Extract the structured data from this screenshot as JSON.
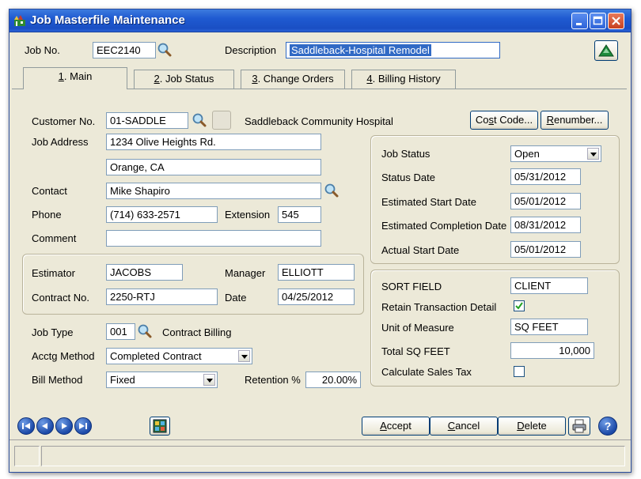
{
  "window": {
    "title": "Job Masterfile Maintenance"
  },
  "header": {
    "job_no_label": "Job No.",
    "job_no_value": "EEC2140",
    "description_label": "Description",
    "description_value": "Saddleback-Hospital Remodel"
  },
  "tabs": [
    {
      "key": "1",
      "label": ". Main"
    },
    {
      "key": "2",
      "label": ". Job Status"
    },
    {
      "key": "3",
      "label": ". Change Orders"
    },
    {
      "key": "4",
      "label": ". Billing History"
    }
  ],
  "customer": {
    "label": "Customer No.",
    "value": "01-SADDLE",
    "name": "Saddleback Community Hospital"
  },
  "buttons": {
    "cost_code": {
      "pre": "Co",
      "key": "s",
      "post": "t Code..."
    },
    "renumber": {
      "key": "R",
      "post": "enumber..."
    },
    "accept": {
      "key": "A",
      "post": "ccept"
    },
    "cancel": {
      "key": "C",
      "post": "ancel"
    },
    "delete": {
      "key": "D",
      "post": "elete"
    }
  },
  "address": {
    "label": "Job Address",
    "line1": "1234 Olive Heights Rd.",
    "line2": "Orange, CA"
  },
  "contact": {
    "label": "Contact",
    "value": "Mike Shapiro"
  },
  "phone": {
    "label": "Phone",
    "value": "(714) 633-2571",
    "ext_label": "Extension",
    "ext_value": "545"
  },
  "comment": {
    "label": "Comment",
    "value": ""
  },
  "estimator": {
    "label": "Estimator",
    "value": "JACOBS",
    "manager_label": "Manager",
    "manager_value": "ELLIOTT"
  },
  "contract": {
    "label": "Contract No.",
    "value": "2250-RTJ",
    "date_label": "Date",
    "date_value": "04/25/2012"
  },
  "job_type": {
    "label": "Job Type",
    "value": "001",
    "desc": "Contract Billing"
  },
  "acctg_method": {
    "label": "Acctg Method",
    "value": "Completed Contract"
  },
  "bill_method": {
    "label": "Bill Method",
    "value": "Fixed",
    "retention_label": "Retention %",
    "retention_value": "20.00%"
  },
  "status_group": {
    "job_status_label": "Job Status",
    "job_status_value": "Open",
    "status_date_label": "Status Date",
    "status_date_value": "05/31/2012",
    "est_start_label": "Estimated Start Date",
    "est_start_value": "05/01/2012",
    "est_completion_label": "Estimated Completion Date",
    "est_completion_value": "08/31/2012",
    "actual_start_label": "Actual Start Date",
    "actual_start_value": "05/01/2012"
  },
  "sort_group": {
    "sort_label": "SORT FIELD",
    "sort_value": "CLIENT",
    "retain_label": "Retain Transaction Detail",
    "retain_checked": true,
    "uom_label": "Unit of Measure",
    "uom_value": "SQ FEET",
    "total_label": "Total SQ FEET",
    "total_value": "10,000",
    "sales_tax_label": "Calculate Sales Tax",
    "sales_tax_checked": false
  },
  "status_bar": {
    "text": ""
  }
}
